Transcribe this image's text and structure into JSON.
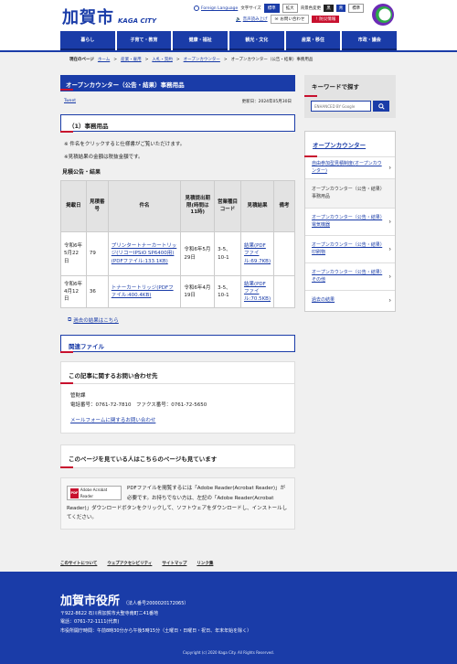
{
  "header": {
    "logo_kanji": "加賀市",
    "logo_en": "KAGA CITY",
    "foreign_language": "Foreign Language",
    "font_size_label": "文字サイズ",
    "font_sizes": [
      "標準",
      "拡大"
    ],
    "color_label": "背景色変更",
    "colors": [
      "黒",
      "青",
      "標準"
    ],
    "read_aloud": "音声読み上げ",
    "inquiry": "お問い合わせ",
    "emergency": "防災情報"
  },
  "nav": [
    "暮らし",
    "子育て・教育",
    "健康・福祉",
    "観光・文化",
    "産業・移住",
    "市政・議会"
  ],
  "breadcrumb": {
    "current_label": "現在のページ",
    "items": [
      "ホーム",
      "産業・雇用",
      "入札・契約",
      "オープンカウンター",
      "オープンカウンター（公告・結果）事務用品"
    ]
  },
  "main": {
    "title": "オープンカウンター（公告・結果）事務用品",
    "tweet": "Tweet",
    "updated": "更新日：2024年05月30日",
    "section1": "（1）事務用品",
    "notes": [
      "※ 件名をクリックすると仕様書がご覧いただけます。",
      "※見積結果の金額は税抜金額です。"
    ],
    "subhead": "見積公告・結果",
    "table": {
      "headers": [
        "掲載日",
        "見積番号",
        "件名",
        "見積提出期限(時間は11時)",
        "営業種目コード",
        "見積結果",
        "備考"
      ],
      "rows": [
        {
          "date": "令和6年5月22日",
          "no": "79",
          "item": "プリンタートナーカートリッジ(リコーIPSiO SP6400用)(PDFファイル:133.1KB)",
          "deadline": "令和6年5月29日",
          "code": "3-5、10-1",
          "result": "結果(PDFファイル:69.7KB)",
          "remark": ""
        },
        {
          "date": "令和6年4月12日",
          "no": "36",
          "item": "トナーカートリッジ(PDFファイル:400.4KB)",
          "deadline": "令和6年4月19日",
          "code": "3-5、10-1",
          "result": "結果(PDFファイル:70.5KB)",
          "remark": ""
        }
      ]
    },
    "past_results": "過去の結果はこちら",
    "related_files": "関連ファイル",
    "inquiry_title": "この記事に関するお問い合わせ先",
    "inquiry_dept": "管財課",
    "inquiry_tel": "電話番号：0761-72-7810　ファクス番号：0761-72-5650",
    "inquiry_mail": "メールフォームに関するお問い合わせ",
    "see_also": "このページを見ている人はこちらのページも見ています",
    "pdf_badge": "Adobe Acrobat Reader",
    "pdf_text": "PDFファイルを閲覧するには「Adobe Reader(Acrobat Reader)」が必要です。お持ちでない方は、左記の「Adobe Reader(Acrobat Reader)」ダウンロードボタンをクリックして、ソフトウェアをダウンロードし、インストールしてください。"
  },
  "sidebar": {
    "search_title": "キーワードで探す",
    "search_placeholder": "ENHANCED BY Google",
    "menu_title": "オープンカウンター",
    "items": [
      "自由参加型見積制度(オープンカウンター)",
      "オープンカウンター（公告・結果）事務用品",
      "オープンカウンター（公告・結果）電気機器",
      "オープンカウンター（公告・結果）印刷物",
      "オープンカウンター（公告・結果）その他",
      "過去の結果"
    ]
  },
  "footer": {
    "links": [
      "このサイトについて",
      "ウェブアクセシビリティ",
      "サイトマップ",
      "リンク集"
    ],
    "name": "加賀市役所",
    "corp_no": "（法人番号2000020172065）",
    "address": "〒922-8622 石川県加賀市大聖寺南町ニ41番地",
    "phone": "電話：0761-72-1111(代表)",
    "hours": "市役所開庁時間：午前8時30分から午後5時15分（土曜日・日曜日・祝日、年末年始を除く）",
    "copyright": "Copyright (c) 2020 Kaga City. All Rights Reserved."
  },
  "colors": {
    "brand": "#1a3ca8",
    "accent": "#c8102e"
  }
}
